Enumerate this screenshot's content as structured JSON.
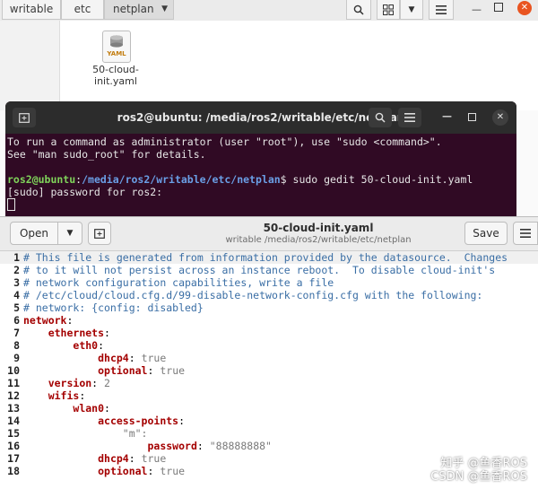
{
  "file_manager": {
    "breadcrumbs": [
      "writable",
      "etc",
      "netplan"
    ],
    "file": {
      "name_line1": "50-cloud-",
      "name_line2": "init.yaml",
      "icon_text": "YAML"
    }
  },
  "terminal": {
    "title": "ros2@ubuntu: /media/ros2/writable/etc/netplan",
    "line1": "To run a command as administrator (user \"root\"), use \"sudo <command>\".",
    "line2": "See \"man sudo_root\" for details.",
    "prompt_user": "ros2@ubuntu",
    "prompt_sep": ":",
    "prompt_path": "/media/ros2/writable/etc/netplan",
    "command": "$ sudo gedit 50-cloud-init.yaml",
    "line4": "[sudo] password for ros2:"
  },
  "gedit": {
    "open_label": "Open",
    "save_label": "Save",
    "title": "50-cloud-init.yaml",
    "subtitle": "writable /media/ros2/writable/etc/netplan",
    "lines": [
      {
        "n": "1",
        "comment": "# This file is generated from information provided by the datasource.  Changes"
      },
      {
        "n": "2",
        "comment": "# to it will not persist across an instance reboot.  To disable cloud-init's"
      },
      {
        "n": "3",
        "comment": "# network configuration capabilities, write a file"
      },
      {
        "n": "4",
        "comment": "# /etc/cloud/cloud.cfg.d/99-disable-network-config.cfg with the following:"
      },
      {
        "n": "5",
        "comment": "# network: {config: disabled}"
      },
      {
        "n": "6",
        "indent": "",
        "key": "network",
        "sep": ":",
        "val": ""
      },
      {
        "n": "7",
        "indent": "    ",
        "key": "ethernets",
        "sep": ":",
        "val": ""
      },
      {
        "n": "8",
        "indent": "        ",
        "key": "eth0",
        "sep": ":",
        "val": ""
      },
      {
        "n": "9",
        "indent": "            ",
        "key": "dhcp4",
        "sep": ": ",
        "val": "true"
      },
      {
        "n": "10",
        "indent": "            ",
        "key": "optional",
        "sep": ": ",
        "val": "true"
      },
      {
        "n": "11",
        "indent": "    ",
        "key": "version",
        "sep": ": ",
        "val": "2"
      },
      {
        "n": "12",
        "indent": "    ",
        "key": "wifis",
        "sep": ":",
        "val": ""
      },
      {
        "n": "13",
        "indent": "        ",
        "key": "wlan0",
        "sep": ":",
        "val": ""
      },
      {
        "n": "14",
        "indent": "            ",
        "key": "access-points",
        "sep": ":",
        "val": ""
      },
      {
        "n": "15",
        "indent": "                ",
        "key": "",
        "sep": "",
        "val": "\"m\":"
      },
      {
        "n": "16",
        "indent": "                    ",
        "key": "password",
        "sep": ": ",
        "val": "\"88888888\""
      },
      {
        "n": "17",
        "indent": "            ",
        "key": "dhcp4",
        "sep": ": ",
        "val": "true"
      },
      {
        "n": "18",
        "indent": "            ",
        "key": "optional",
        "sep": ": ",
        "val": "true"
      }
    ]
  },
  "watermark": {
    "line1": "知乎 @鱼香ROS",
    "line2": "CSDN @鱼香ROS"
  },
  "colors": {
    "terminal_bg": "#300a24",
    "comment": "#3a6ea5",
    "key": "#a40000",
    "prompt_user": "#7fd35a",
    "prompt_path": "#6a9fe6"
  }
}
